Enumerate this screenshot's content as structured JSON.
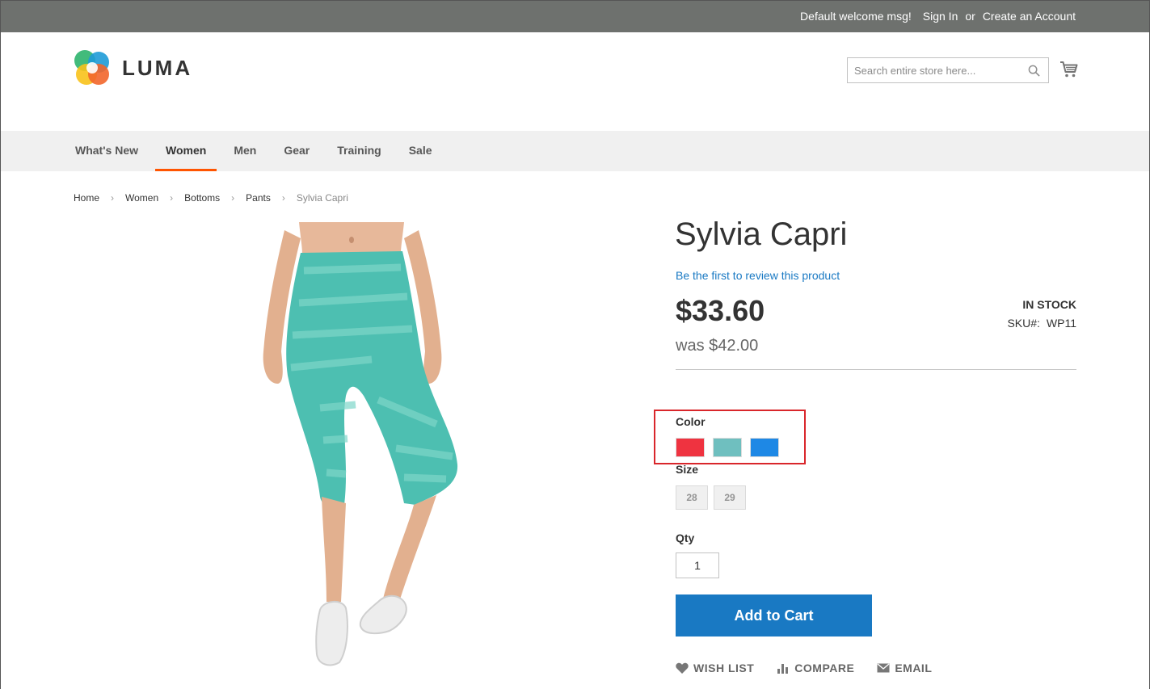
{
  "top_bar": {
    "welcome": "Default welcome msg!",
    "sign_in": "Sign In",
    "or": "or",
    "create_account": "Create an Account"
  },
  "header": {
    "logo_text": "LUMA",
    "search_placeholder": "Search entire store here...",
    "search_icon": "search-icon",
    "cart_icon": "cart-icon"
  },
  "nav": {
    "items": [
      {
        "label": "What's New",
        "active": false
      },
      {
        "label": "Women",
        "active": true
      },
      {
        "label": "Men",
        "active": false
      },
      {
        "label": "Gear",
        "active": false
      },
      {
        "label": "Training",
        "active": false
      },
      {
        "label": "Sale",
        "active": false
      }
    ],
    "active_color": "#ff5501"
  },
  "breadcrumb": [
    "Home",
    "Women",
    "Bottoms",
    "Pants",
    "Sylvia Capri"
  ],
  "product": {
    "name": "Sylvia Capri",
    "review_link": "Be the first to review this product",
    "price": "$33.60",
    "old_price": "was $42.00",
    "stock": "IN STOCK",
    "sku_label": "SKU#:",
    "sku_value": "WP11",
    "color_label": "Color",
    "colors": [
      {
        "name": "Red",
        "hex": "#ef3340"
      },
      {
        "name": "Turquoise",
        "hex": "#6fbfbf"
      },
      {
        "name": "Blue",
        "hex": "#1e88e5"
      }
    ],
    "size_label": "Size",
    "sizes": [
      "28",
      "29"
    ],
    "qty_label": "Qty",
    "qty_value": "1",
    "add_to_cart": "Add to Cart",
    "wish_list": "WISH LIST",
    "compare": "COMPARE",
    "email": "EMAIL"
  },
  "colors": {
    "accent": "#1979c3",
    "topbar": "#6e716e",
    "highlight": "#d9262b"
  }
}
